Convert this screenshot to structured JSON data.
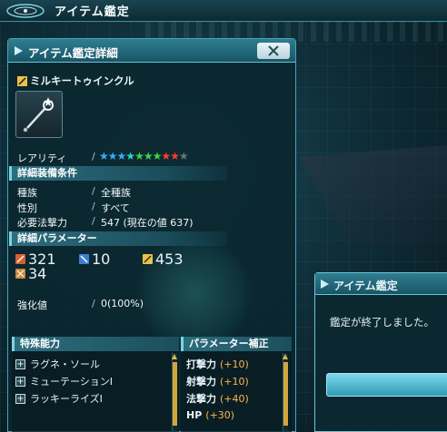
{
  "topbar": {
    "title": "アイテム鑑定"
  },
  "details_window": {
    "title": "アイテム鑑定詳細",
    "item_name": "ミルキートゥインクル",
    "rarity_label": "レアリティ",
    "rarity_stars": {
      "filled": 9,
      "total": 10
    },
    "requirements": {
      "heading": "詳細装備条件",
      "rows": [
        {
          "label": "種族",
          "value": "全種族"
        },
        {
          "label": "性別",
          "value": "すべて"
        },
        {
          "label": "必要法撃力",
          "value": "547 (現在の値 637)"
        }
      ]
    },
    "parameters": {
      "heading": "詳細パラメーター",
      "melee": "321",
      "ranged": "10",
      "tech": "453",
      "dex": "34"
    },
    "grind": {
      "label": "強化値",
      "value": "0(100%)"
    },
    "special_abilities": {
      "heading": "特殊能力",
      "items": [
        "ラグネ・ソール",
        "ミューテーションI",
        "ラッキーライズI"
      ]
    },
    "param_bonus": {
      "heading": "パラメーター補正",
      "items": [
        {
          "label": "打撃力",
          "value": "(+10)"
        },
        {
          "label": "射撃力",
          "value": "(+10)"
        },
        {
          "label": "法撃力",
          "value": "(+40)"
        },
        {
          "label": "HP",
          "value": "(+30)"
        }
      ]
    }
  },
  "popup": {
    "title": "アイテム鑑定",
    "message": "鑑定が終了しました。"
  },
  "colors": {
    "accent": "#4aa3b6",
    "bonus_value": "#ffb24a",
    "star_blue": "#3fa9f5",
    "star_cyan": "#2fd6c8",
    "star_green": "#3fd24a",
    "star_red": "#ff3b2f",
    "star_empty": "#6b7479"
  }
}
